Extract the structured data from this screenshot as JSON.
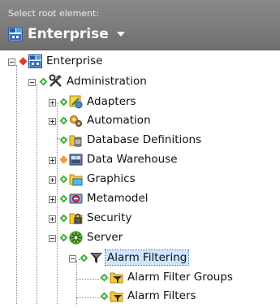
{
  "header": {
    "caption": "Select root element:",
    "root_label": "Enterprise",
    "root_icon": "enterprise-icon"
  },
  "tree": {
    "root": {
      "label": "Enterprise",
      "icon": "enterprise-icon",
      "status": "red",
      "expanded": true
    },
    "administration": {
      "label": "Administration",
      "icon": "tools-icon",
      "status": "green",
      "expanded": true
    },
    "children": [
      {
        "label": "Adapters",
        "icon": "adapters-icon",
        "status": "green",
        "expander": "plus"
      },
      {
        "label": "Automation",
        "icon": "automation-icon",
        "status": "green",
        "expander": "plus"
      },
      {
        "label": "Database Definitions",
        "icon": "database-icon",
        "status": "green",
        "expander": "none"
      },
      {
        "label": "Data Warehouse",
        "icon": "warehouse-icon",
        "status": "orange",
        "expander": "plus"
      },
      {
        "label": "Graphics",
        "icon": "graphics-folder-icon",
        "status": "green",
        "expander": "plus"
      },
      {
        "label": "Metamodel",
        "icon": "metamodel-icon",
        "status": "green",
        "expander": "plus"
      },
      {
        "label": "Security",
        "icon": "security-icon",
        "status": "green",
        "expander": "plus"
      },
      {
        "label": "Server",
        "icon": "server-icon",
        "status": "green",
        "expander": "minus"
      }
    ],
    "alarm_filtering": {
      "label": "Alarm Filtering",
      "icon": "filter-icon",
      "status": "green",
      "selected": true
    },
    "alarm_children": [
      {
        "label": "Alarm Filter Groups",
        "icon": "filter-groups-icon",
        "status": "green"
      },
      {
        "label": "Alarm Filters",
        "icon": "filters-icon",
        "status": "green"
      }
    ]
  },
  "colors": {
    "header_bg": "#7c7c7c",
    "status_green": "#3fb13f",
    "status_red": "#e33a2e",
    "status_orange": "#f3a23d",
    "selection": "#cce6ff"
  }
}
